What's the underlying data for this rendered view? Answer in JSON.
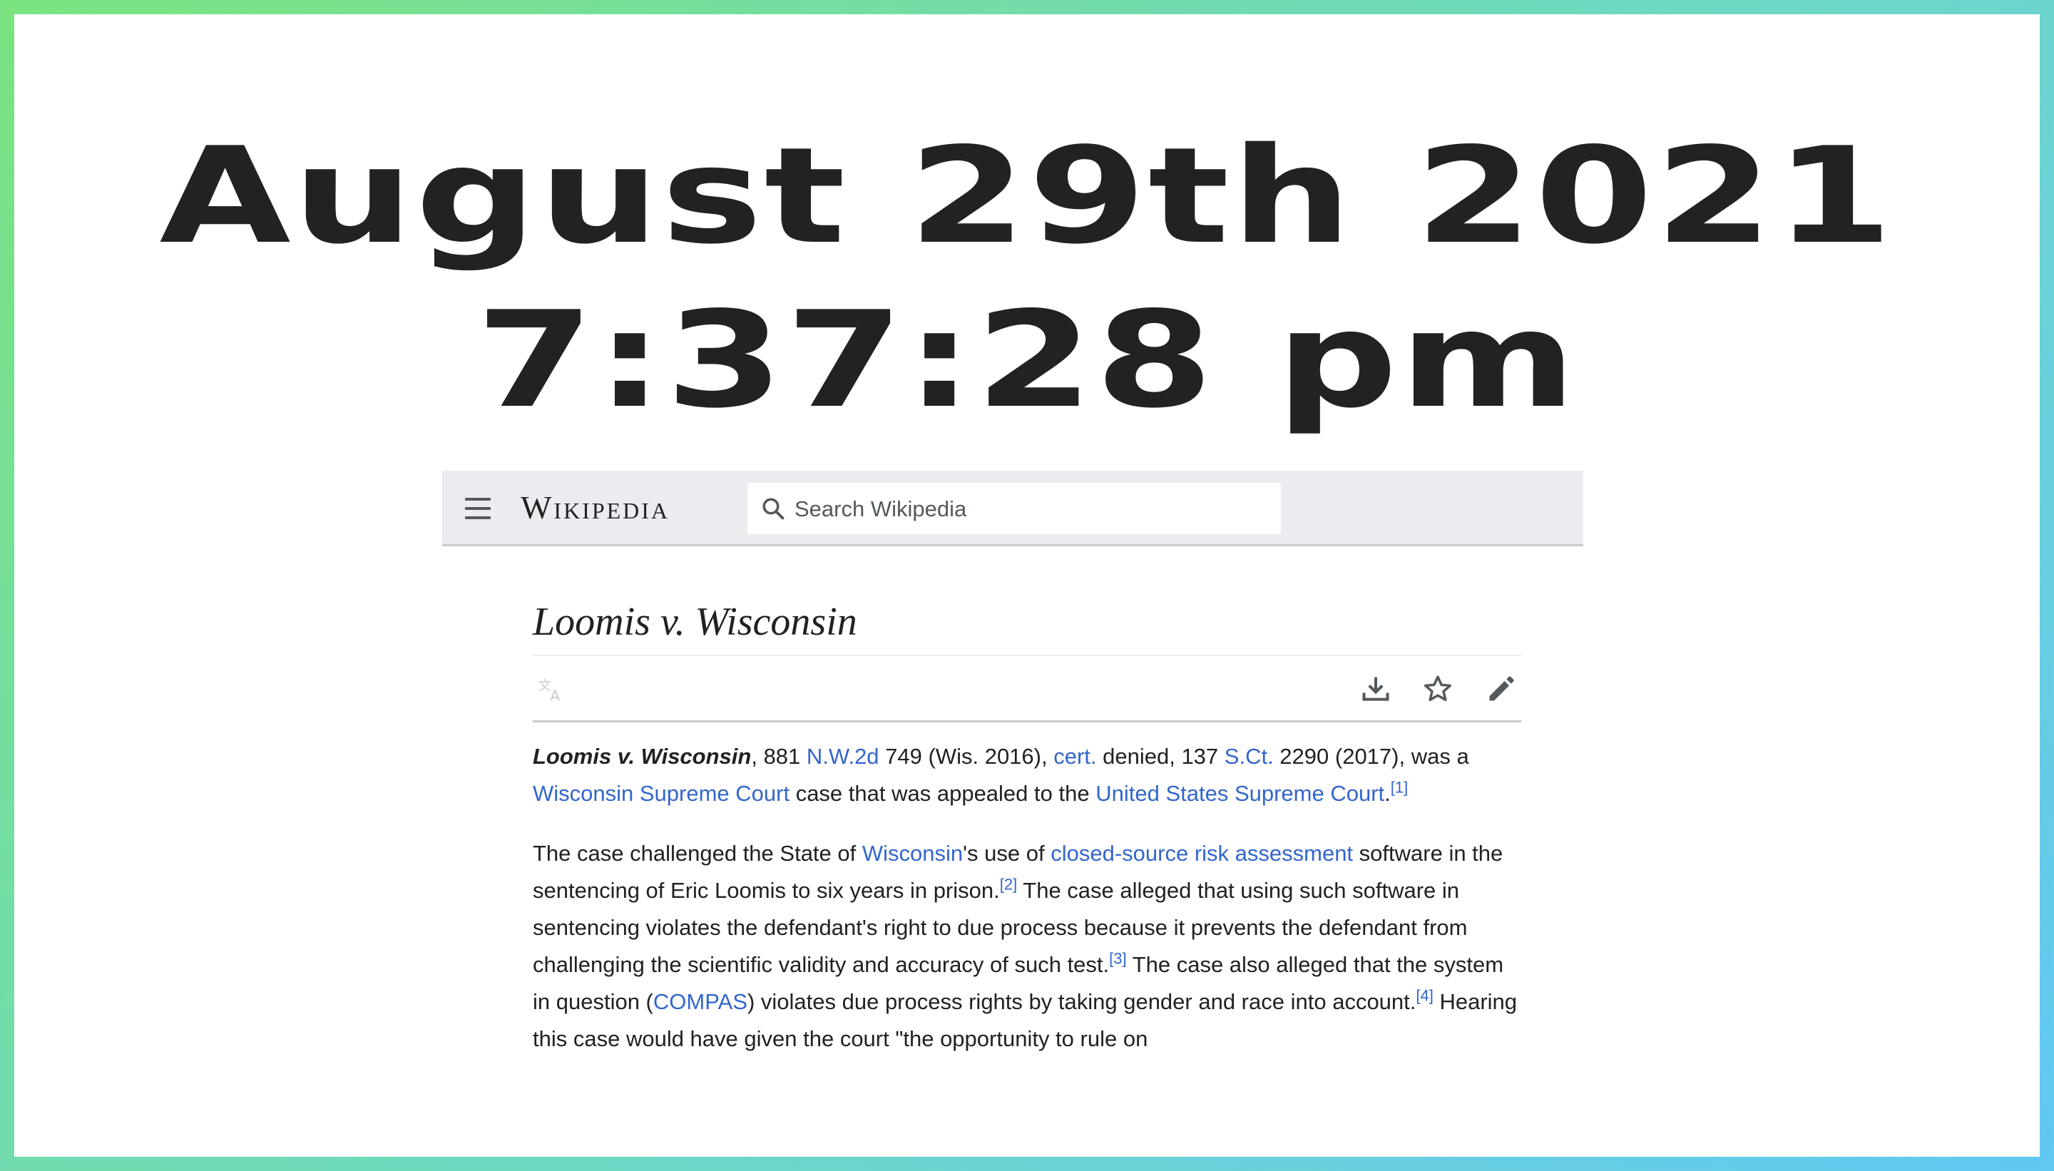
{
  "overlay": {
    "date": "August 29th 2021",
    "time": "7:37:28 pm"
  },
  "header": {
    "wordmark": "Wikipedia",
    "search": {
      "placeholder": "Search Wikipedia",
      "value": ""
    },
    "icons": [
      "menu-icon",
      "search-icon"
    ]
  },
  "article": {
    "title": "Loomis v. Wisconsin",
    "action_icons": [
      "language-icon",
      "download-icon",
      "star-icon",
      "edit-icon"
    ],
    "p1": {
      "lead": "Loomis v. Wisconsin",
      "t1": ", 881 ",
      "l1": "N.W.2d",
      "t2": " 749 (Wis. 2016), ",
      "l2": "cert.",
      "t3": " denied, 137 ",
      "l3": "S.Ct.",
      "t4": " 2290 (2017), was a ",
      "l4": "Wisconsin Supreme Court",
      "t5": " case that was appealed to the ",
      "l5": "United States Supreme Court",
      "t6": ".",
      "ref1": "[1]"
    },
    "p2": {
      "t1": "The case challenged the State of ",
      "l1": "Wisconsin",
      "t2": "'s use of ",
      "l2": "closed-source risk assessment",
      "t3": " software in the sentencing of Eric Loomis to six years in prison.",
      "ref2": "[2]",
      "t4": " The case alleged that using such software in sentencing violates the defendant's right to due process because it prevents the defendant from challenging the scientific validity and accuracy of such test.",
      "ref3": "[3]",
      "t5": " The case also alleged that the system in question (",
      "l3": "COMPAS",
      "t6": ") violates due process rights by taking gender and race into account.",
      "ref4": "[4]",
      "t7": " Hearing this case would have given the court \"the opportunity to rule on"
    }
  },
  "colors": {
    "link": "#3366cc",
    "text": "#202122",
    "header_bg": "#eaecf0",
    "frame_gradient": [
      "#7be37f",
      "#62c8f4"
    ]
  }
}
